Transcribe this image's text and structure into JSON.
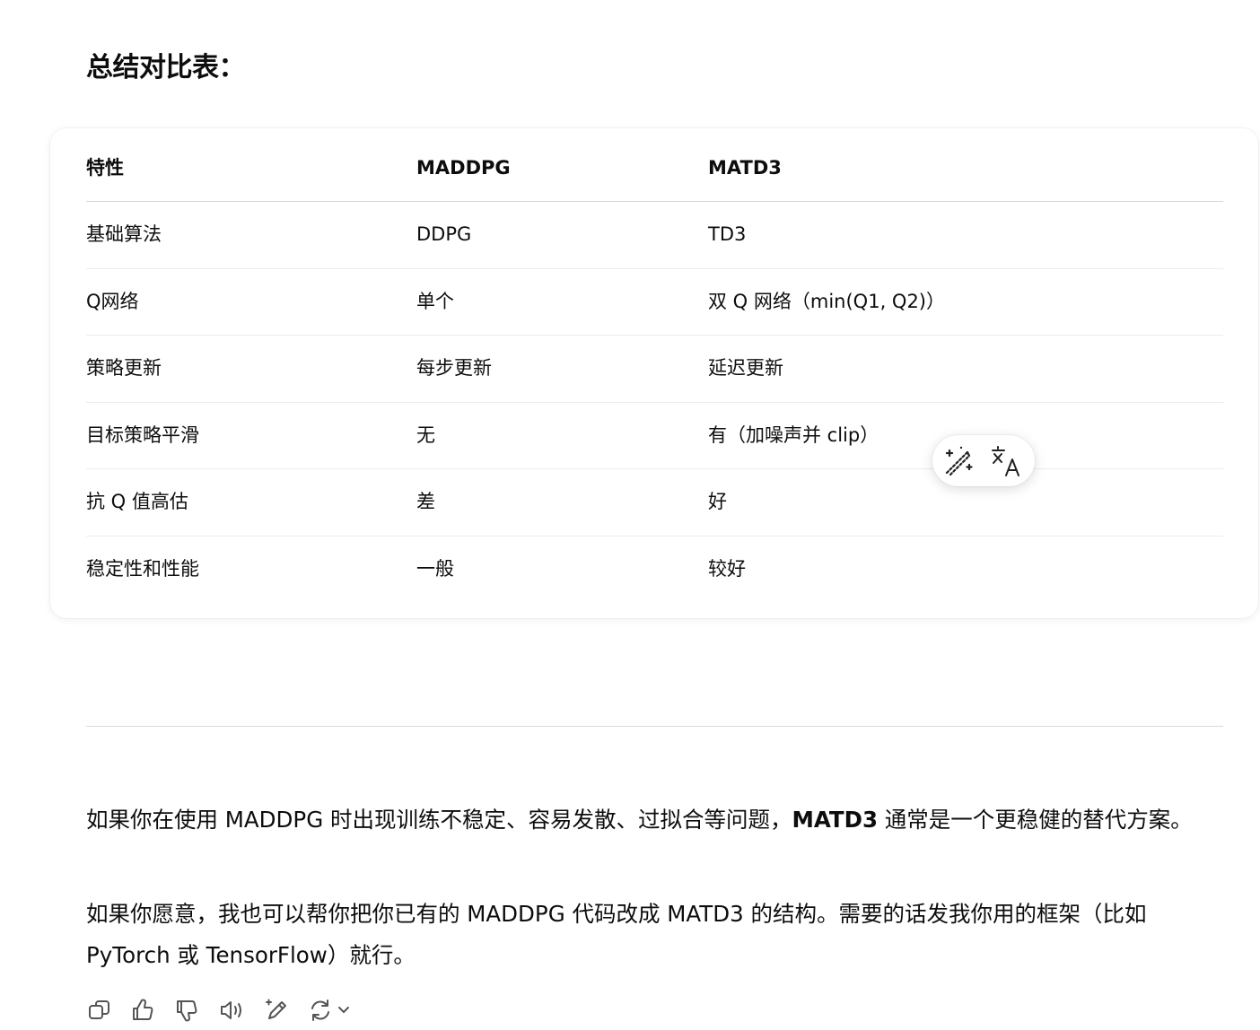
{
  "heading": "总结对比表：",
  "table": {
    "headers": [
      "特性",
      "MADDPG",
      "MATD3"
    ],
    "rows": [
      [
        "基础算法",
        "DDPG",
        "TD3"
      ],
      [
        "Q网络",
        "单个",
        "双 Q 网络（min(Q1, Q2)）"
      ],
      [
        "策略更新",
        "每步更新",
        "延迟更新"
      ],
      [
        "目标策略平滑",
        "无",
        "有（加噪声并 clip）"
      ],
      [
        "抗 Q 值高估",
        "差",
        "好"
      ],
      [
        "稳定性和性能",
        "一般",
        "较好"
      ]
    ]
  },
  "floating_toolbar": {
    "icons": [
      "magic-wand-icon",
      "translate-icon"
    ]
  },
  "paragraph1": {
    "before": "如果你在使用 MADDPG 时出现训练不稳定、容易发散、过拟合等问题，",
    "bold": "MATD3",
    "after": " 通常是一个更稳健的替代方案。"
  },
  "paragraph2": "如果你愿意，我也可以帮你把你已有的 MADDPG 代码改成 MATD3 的结构。需要的话发我你用的框架（比如 PyTorch 或 TensorFlow）就行。",
  "action_bar": {
    "icons": [
      "copy-icon",
      "thumbs-up-icon",
      "thumbs-down-icon",
      "read-aloud-icon",
      "edit-icon",
      "regenerate-icon",
      "chevron-down-icon"
    ]
  }
}
